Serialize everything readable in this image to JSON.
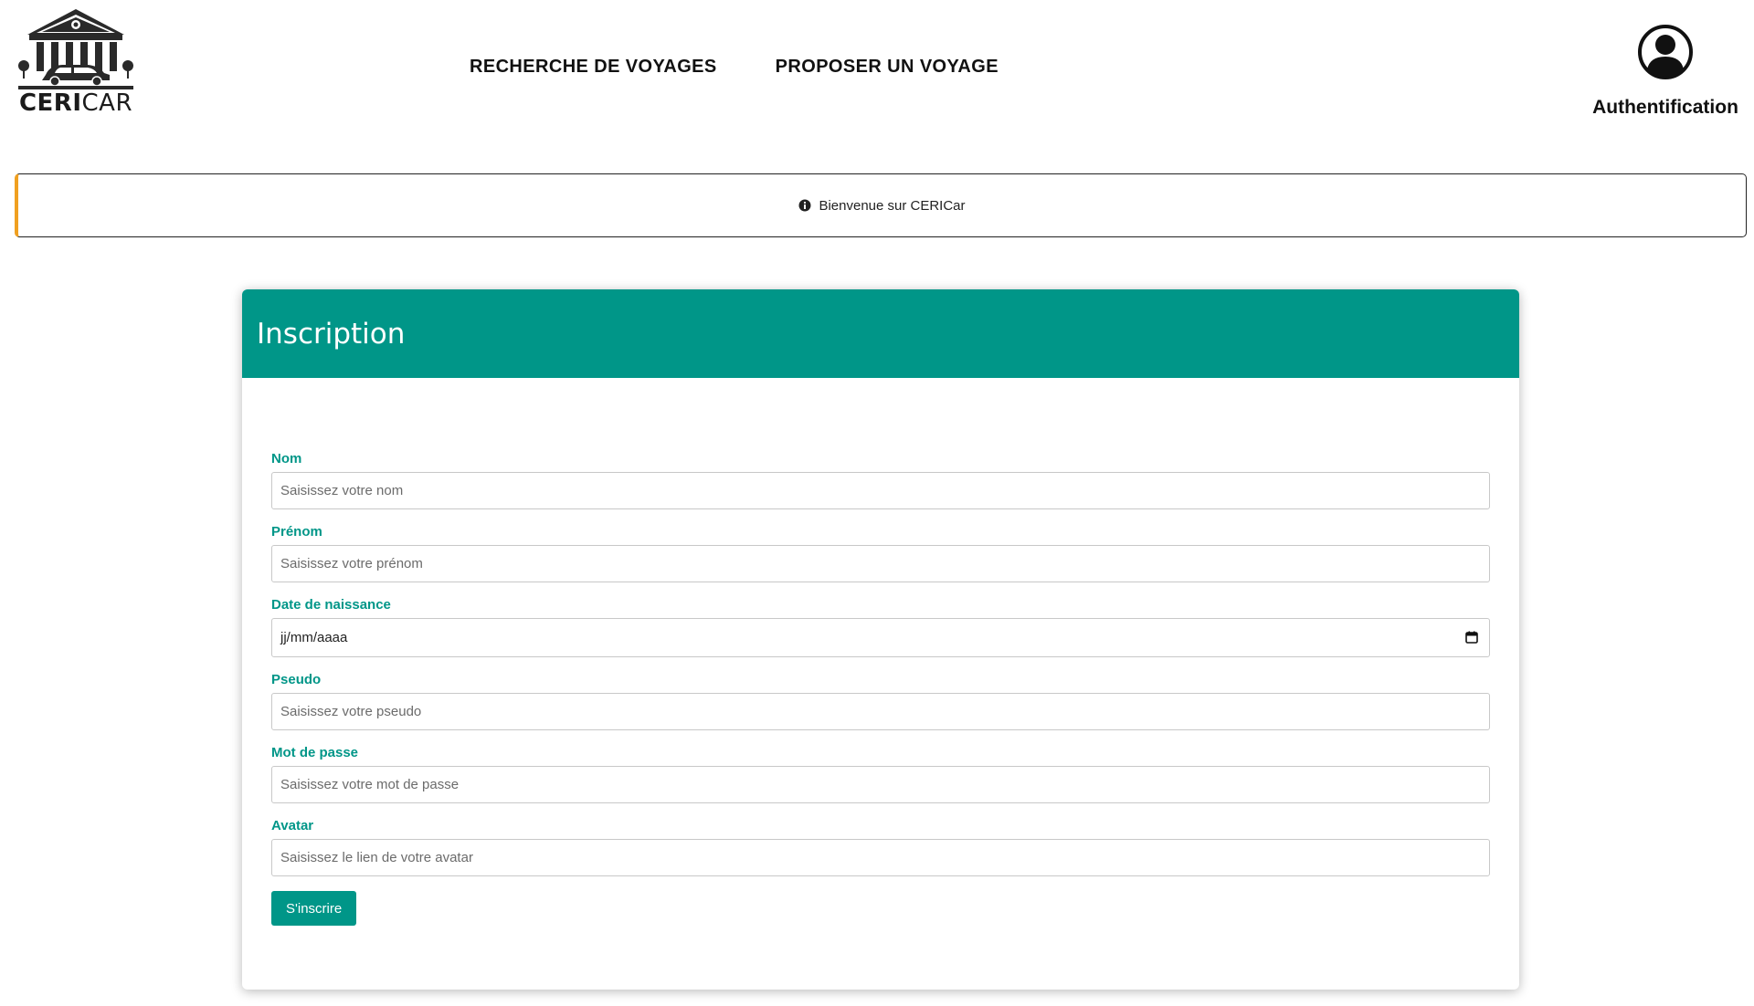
{
  "brand": {
    "logo_text_bold": "CERI",
    "logo_text_regular": "CAR"
  },
  "nav": {
    "items": [
      {
        "label": "RECHERCHE DE VOYAGES"
      },
      {
        "label": "PROPOSER UN VOYAGE"
      }
    ]
  },
  "auth": {
    "label": "Authentification",
    "icon": "user-circle-icon"
  },
  "banner": {
    "text": "Bienvenue sur CERICar",
    "icon": "info-circle-icon",
    "accent": "#f0a020"
  },
  "card": {
    "title": "Inscription",
    "header_color": "#009688",
    "fields": {
      "nom": {
        "label": "Nom",
        "placeholder": "Saisissez votre nom"
      },
      "prenom": {
        "label": "Prénom",
        "placeholder": "Saisissez votre prénom"
      },
      "date": {
        "label": "Date de naissance",
        "value": "jj/mm/aaaa"
      },
      "pseudo": {
        "label": "Pseudo",
        "placeholder": "Saisissez votre pseudo"
      },
      "password": {
        "label": "Mot de passe",
        "placeholder": "Saisissez votre mot de passe"
      },
      "avatar": {
        "label": "Avatar",
        "placeholder": "Saisissez le lien de votre avatar"
      }
    },
    "submit_label": "S'inscrire"
  }
}
